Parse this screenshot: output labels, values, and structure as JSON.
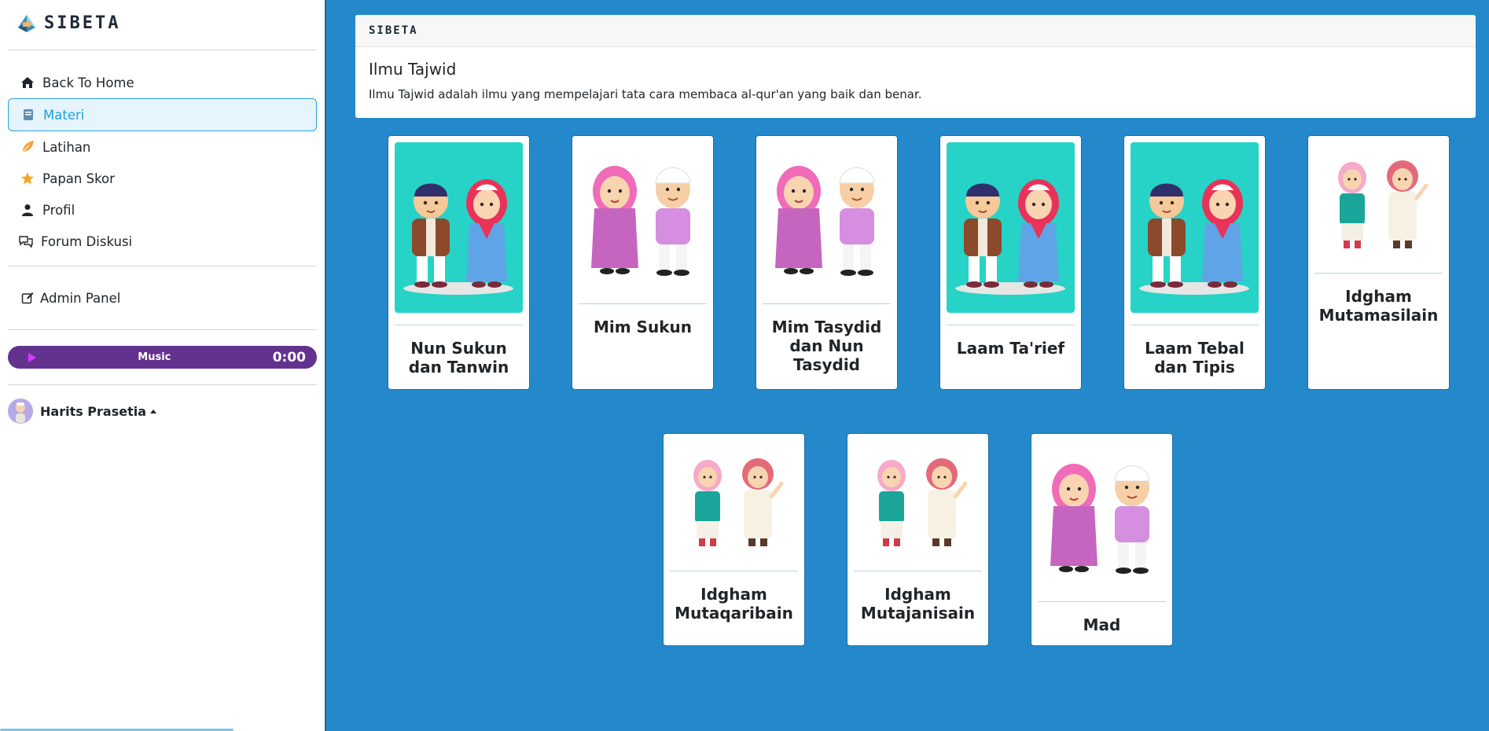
{
  "brand": {
    "name": "SIBETA"
  },
  "sidebar": {
    "items": [
      {
        "label": "Back To Home",
        "icon": "home-icon"
      },
      {
        "label": "Materi",
        "icon": "book-icon",
        "active": true
      },
      {
        "label": "Latihan",
        "icon": "leaf-icon"
      },
      {
        "label": "Papan Skor",
        "icon": "star-icon"
      },
      {
        "label": "Profil",
        "icon": "person-icon"
      },
      {
        "label": "Forum Diskusi",
        "icon": "chat-icon"
      }
    ],
    "admin": {
      "label": "Admin Panel",
      "icon": "edit-icon"
    },
    "music": {
      "label": "Music",
      "time": "0:00"
    },
    "user": {
      "name": "Harits Prasetia"
    }
  },
  "header": {
    "brand": "SIBETA",
    "title": "Ilmu Tajwid",
    "description": "Ilmu Tajwid adalah ilmu yang mempelajari tata cara membaca al-qur'an yang baik dan benar."
  },
  "cards": [
    {
      "title": "Nun Sukun dan Tanwin",
      "image": "praying-kids-image"
    },
    {
      "title": "Mim Sukun",
      "image": "pink-kids-image"
    },
    {
      "title": "Mim Tasydid dan Nun Tasydid",
      "image": "pink-kids-image"
    },
    {
      "title": "Laam Ta'rief",
      "image": "praying-kids-image"
    },
    {
      "title": "Laam Tebal dan Tipis",
      "image": "praying-kids-image"
    },
    {
      "title": "Idgham Mutamasilain",
      "image": "waving-kids-image"
    },
    {
      "title": "Idgham Mutaqaribain",
      "image": "waving-kids-image"
    },
    {
      "title": "Idgham Mutajanisain",
      "image": "waving-kids-image"
    },
    {
      "title": "Mad",
      "image": "pink-kids-image"
    }
  ],
  "colors": {
    "background": "#2389cb",
    "accent": "#1ba2dc",
    "music": "#63328f",
    "teal": "#26d3c6"
  }
}
